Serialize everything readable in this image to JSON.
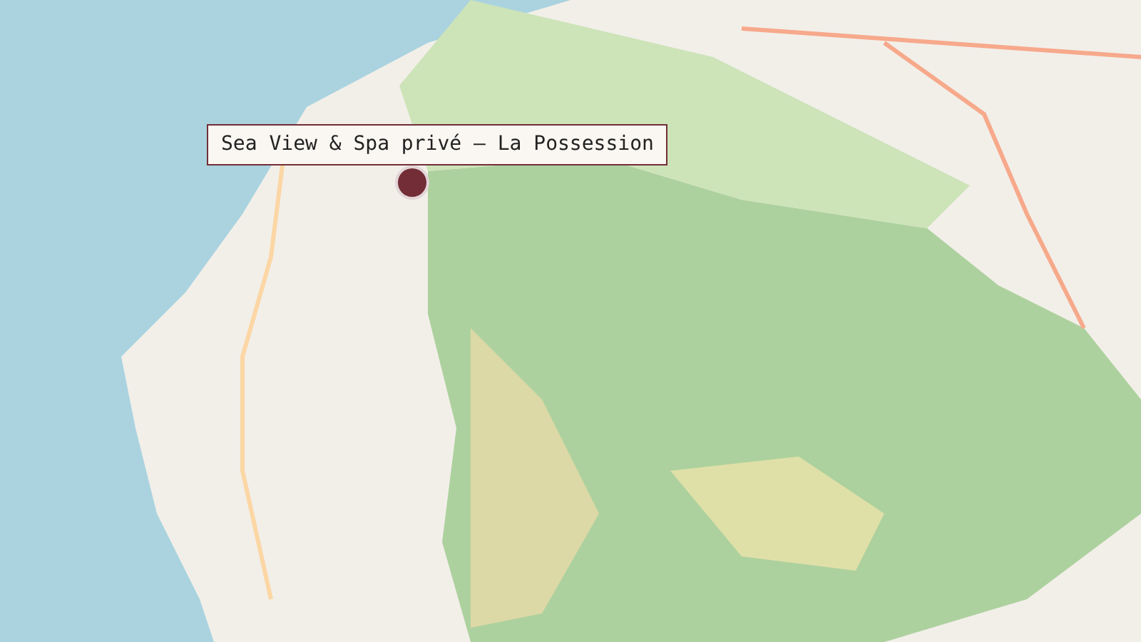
{
  "map": {
    "marker": {
      "label": "Sea View & Spa privé — La Possession"
    }
  }
}
